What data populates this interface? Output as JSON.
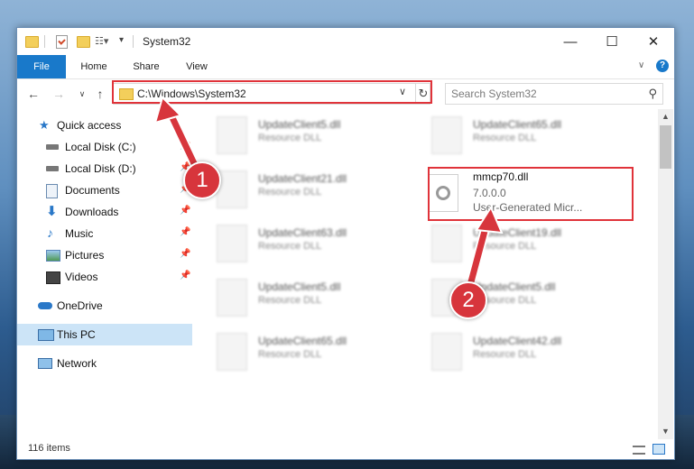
{
  "window": {
    "title": "System32"
  },
  "ribbon": {
    "tabs": [
      "File",
      "Home",
      "Share",
      "View"
    ]
  },
  "address": {
    "path": "C:\\Windows\\System32",
    "search_placeholder": "Search System32"
  },
  "nav_pane": {
    "items": [
      {
        "label": "Quick access",
        "icon": "star-icon",
        "pinned": false
      },
      {
        "label": "Local Disk (C:)",
        "icon": "drive-icon",
        "pinned": true
      },
      {
        "label": "Local Disk (D:)",
        "icon": "drive-icon",
        "pinned": true
      },
      {
        "label": "Documents",
        "icon": "documents-icon",
        "pinned": true
      },
      {
        "label": "Downloads",
        "icon": "download-arrow-icon",
        "pinned": true
      },
      {
        "label": "Music",
        "icon": "music-note-icon",
        "pinned": true
      },
      {
        "label": "Pictures",
        "icon": "pictures-icon",
        "pinned": true
      },
      {
        "label": "Videos",
        "icon": "film-icon",
        "pinned": true
      },
      {
        "label": "OneDrive",
        "icon": "cloud-icon",
        "pinned": false
      },
      {
        "label": "This PC",
        "icon": "monitor-icon",
        "pinned": false,
        "selected": true
      },
      {
        "label": "Network",
        "icon": "network-icon",
        "pinned": false
      }
    ]
  },
  "files": {
    "left_column": [
      {
        "name": "UpdateClient5.dll",
        "desc": "Resource DLL"
      },
      {
        "name": "UpdateClient21.dll",
        "desc": "Resource DLL"
      },
      {
        "name": "UpdateClient63.dll",
        "desc": "Resource DLL"
      },
      {
        "name": "UpdateClient5.dll",
        "desc": "Resource DLL"
      },
      {
        "name": "UpdateClient65.dll",
        "desc": "Resource DLL"
      }
    ],
    "right_column": [
      {
        "name": "UpdateClient65.dll",
        "desc": "Resource DLL"
      },
      {
        "name": "mmcp70.dll",
        "version": "7.0.0.0",
        "desc": "User-Generated Micr..."
      },
      {
        "name": "UpdateClient19.dll",
        "desc": "Resource DLL"
      },
      {
        "name": "UpdateClient5.dll",
        "desc": "Resource DLL"
      },
      {
        "name": "UpdateClient42.dll",
        "desc": "Resource DLL"
      }
    ]
  },
  "status": {
    "item_count": "116 items"
  },
  "callouts": [
    "1",
    "2"
  ],
  "colors": {
    "accent": "#1979ca",
    "highlight": "#e0333a",
    "selection": "#cce4f7"
  }
}
